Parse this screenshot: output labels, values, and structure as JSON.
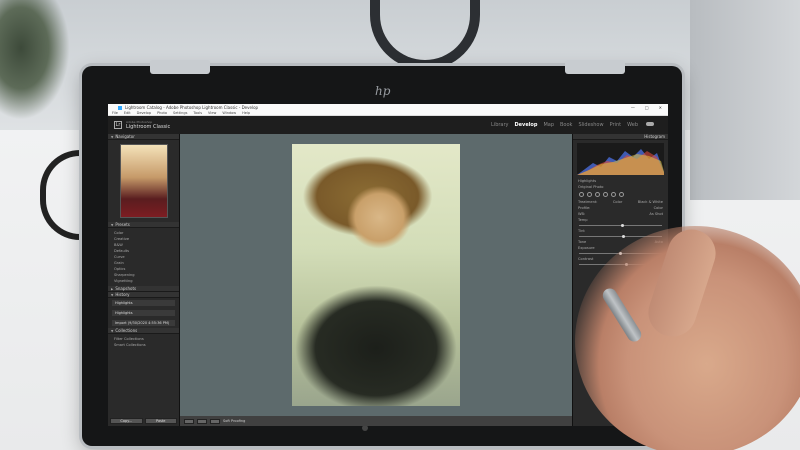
{
  "window": {
    "title": "Lightroom Catalog - Adobe Photoshop Lightroom Classic - Develop",
    "controls": [
      "—",
      "□",
      "✕"
    ]
  },
  "menu": [
    "File",
    "Edit",
    "Develop",
    "Photo",
    "Settings",
    "Tools",
    "View",
    "Window",
    "Help"
  ],
  "identity": {
    "logo": "Lr",
    "line1": "Adobe Photoshop",
    "line2": "Lightroom Classic"
  },
  "modules": {
    "items": [
      "Library",
      "Develop",
      "Map",
      "Book",
      "Slideshow",
      "Print",
      "Web"
    ],
    "active": "Develop"
  },
  "left": {
    "navigator": "Navigator",
    "presets_title": "Presets",
    "presets": [
      "Color",
      "Creative",
      "B&W",
      "Defaults",
      "Curve",
      "Grain",
      "Optics",
      "Sharpening",
      "Vignetting"
    ],
    "snapshots": "Snapshots",
    "history_title": "History",
    "history": [
      "Highlights",
      "Highlights",
      "Import (9/30/2020 4:55:36 PM)"
    ],
    "collections": "Collections",
    "collection_items": [
      "Filter Collections",
      "Smart Collections"
    ],
    "copy": "Copy...",
    "paste": "Paste"
  },
  "toolbar": {
    "softproof": "Soft Proofing"
  },
  "right": {
    "histogram": "Histogram",
    "highlights": "Highlights",
    "original_photo": "Original Photo",
    "treatment": "Treatment:",
    "color": "Color",
    "bw": "Black & White",
    "profile": "Profile:",
    "profile_value": "Color",
    "wb": "WB:",
    "wb_value": "As Shot",
    "temp": "Temp",
    "tint": "Tint",
    "tone": "Tone",
    "auto": "Auto",
    "exposure": "Exposure",
    "contrast": "Contrast"
  },
  "colors": {
    "accent": "#31a8ff",
    "panel": "#2a2a2a",
    "canvas": "#5d6a6c"
  }
}
